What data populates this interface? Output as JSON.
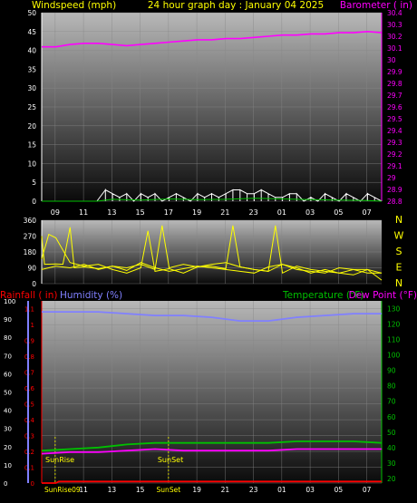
{
  "header": {
    "left_label": "Windspeed (mph)",
    "title": "24 hour graph day : January 04 2025",
    "right_label": "Barometer ( in)"
  },
  "lower_header": {
    "rainfall_label": "Rainfall ( in)",
    "humidity_label": "Humidity (%)",
    "temperature_label": "Temperature (°F)",
    "dewpoint_label": "Dew Point (°F)"
  },
  "colors": {
    "wind": "#ffffff",
    "gust": "#00c000",
    "barometer": "#ff00ff",
    "direction": "#ffff00",
    "rain": "#ff0000",
    "humidity": "#8080ff",
    "temperature": "#00c000",
    "dewpoint": "#ff00ff",
    "title": "#ffff00"
  },
  "chart_data": [
    {
      "type": "line",
      "name": "wind-barometer",
      "x_ticks": [
        "09",
        "11",
        "13",
        "15",
        "17",
        "19",
        "21",
        "23",
        "01",
        "03",
        "05",
        "07"
      ],
      "left_axis": {
        "ticks": [
          0,
          5,
          10,
          15,
          20,
          25,
          30,
          35,
          40,
          45,
          50
        ],
        "ylim": [
          0,
          50
        ]
      },
      "right_axis": {
        "ticks": [
          28.8,
          28.9,
          29,
          29.1,
          29.2,
          29.3,
          29.4,
          29.5,
          29.6,
          29.7,
          29.8,
          29.9,
          30,
          30.1,
          30.2,
          30.3,
          30.4
        ],
        "ylim": [
          28.8,
          30.4
        ]
      },
      "series": [
        {
          "key": "barometer",
          "axis": "right",
          "x": [
            0,
            1,
            2,
            3,
            4,
            5,
            6,
            7,
            8,
            9,
            10,
            11,
            12,
            13,
            14,
            15,
            16,
            17,
            18,
            19,
            20,
            21,
            22,
            23,
            24
          ],
          "values": [
            30.11,
            30.11,
            30.13,
            30.14,
            30.14,
            30.13,
            30.12,
            30.13,
            30.14,
            30.15,
            30.16,
            30.17,
            30.17,
            30.18,
            30.18,
            30.19,
            30.2,
            30.21,
            30.21,
            30.22,
            30.22,
            30.23,
            30.23,
            30.24,
            30.23
          ]
        },
        {
          "key": "wind",
          "axis": "left",
          "x": [
            3.9,
            4.5,
            5,
            5.5,
            6,
            6.5,
            7,
            7.5,
            8,
            8.5,
            9,
            9.5,
            10,
            10.5,
            11,
            11.5,
            12,
            12.5,
            13,
            13.5,
            14,
            14.5,
            15,
            15.5,
            16,
            16.5,
            17,
            17.5,
            18,
            18.5,
            19,
            19.5,
            20,
            20.5,
            21,
            21.5,
            22,
            22.5,
            23,
            23.5,
            24
          ],
          "values": [
            0,
            3,
            2,
            1,
            2,
            0,
            2,
            1,
            2,
            0,
            1,
            2,
            1,
            0,
            2,
            1,
            2,
            1,
            2,
            3,
            3,
            2,
            2,
            3,
            2,
            1,
            1,
            2,
            2,
            0,
            1,
            0,
            2,
            1,
            0,
            2,
            1,
            0,
            2,
            1,
            0
          ]
        },
        {
          "key": "gust",
          "axis": "left",
          "x": [
            0,
            3.9,
            5,
            7,
            9,
            11,
            13,
            15,
            17,
            19,
            21,
            23,
            24
          ],
          "values": [
            0,
            0,
            0.5,
            0.3,
            0.6,
            0.4,
            0.5,
            0.8,
            0.6,
            0.4,
            0.3,
            0.2,
            0
          ]
        }
      ]
    },
    {
      "type": "line",
      "name": "wind-direction",
      "y_ticks": [
        0,
        90,
        180,
        270,
        360
      ],
      "ylim": [
        0,
        360
      ],
      "compass": [
        "N",
        "W",
        "S",
        "E",
        "N"
      ],
      "series": [
        {
          "key": "direction",
          "x": [
            0,
            0.2,
            1,
            1.5,
            2,
            2.3,
            3,
            4,
            5,
            6,
            7,
            8,
            8.5,
            9,
            10,
            11,
            12,
            13,
            13.5,
            14,
            15,
            16,
            16.5,
            17,
            18,
            19,
            20,
            21,
            22,
            23,
            24
          ],
          "values": [
            270,
            110,
            112,
            110,
            320,
            90,
            95,
            85,
            100,
            90,
            110,
            80,
            330,
            90,
            110,
            95,
            100,
            85,
            330,
            95,
            80,
            70,
            330,
            60,
            100,
            80,
            70,
            60,
            80,
            80,
            60
          ]
        },
        {
          "key": "direction",
          "x": [
            0,
            0.5,
            1,
            2,
            3,
            4,
            5,
            6,
            7,
            7.5,
            8,
            9,
            10,
            11,
            12,
            13,
            14,
            15,
            16,
            17,
            18,
            19,
            20,
            21,
            22,
            23,
            24
          ],
          "values": [
            140,
            280,
            260,
            120,
            100,
            110,
            80,
            60,
            90,
            300,
            70,
            85,
            60,
            95,
            110,
            120,
            95,
            80,
            70,
            110,
            90,
            60,
            80,
            60,
            50,
            80,
            20
          ]
        },
        {
          "key": "direction",
          "x": [
            0,
            1,
            2,
            3,
            3.5,
            4,
            5,
            6,
            7,
            8,
            9,
            10,
            11,
            12,
            13,
            14,
            15,
            16,
            17,
            18,
            19,
            20,
            21,
            22,
            23,
            24
          ],
          "values": [
            80,
            100,
            90,
            110,
            95,
            80,
            100,
            75,
            120,
            90,
            70,
            85,
            100,
            90,
            80,
            70,
            60,
            95,
            110,
            80,
            70,
            60,
            90,
            80,
            60,
            60
          ]
        }
      ]
    },
    {
      "type": "line",
      "name": "rain-humidity-temp",
      "rain_axis": {
        "ticks": [
          0,
          0.1,
          0.2,
          0.3,
          0.4,
          0.5,
          0.6,
          0.7,
          0.8,
          0.9,
          1,
          1.1
        ],
        "ylim": [
          0,
          1.15
        ]
      },
      "humidity_axis": {
        "ticks": [
          0,
          10,
          20,
          30,
          40,
          50,
          60,
          70,
          80,
          90,
          100
        ],
        "ylim": [
          0,
          100
        ]
      },
      "temp_axis": {
        "ticks": [
          20,
          30,
          40,
          50,
          60,
          70,
          80,
          90,
          100,
          110,
          120,
          130
        ],
        "ylim": [
          17,
          135
        ]
      },
      "annotations": [
        "SunRise",
        "SunSet"
      ],
      "bottom_labels": [
        "SunRise09",
        "11",
        "13",
        "15",
        "SunSet",
        "19",
        "21",
        "23",
        "01",
        "03",
        "05",
        "07"
      ],
      "series": [
        {
          "key": "humidity",
          "x": [
            0,
            2,
            4,
            6,
            8,
            10,
            12,
            14,
            16,
            18,
            20,
            22,
            24
          ],
          "values": [
            94,
            94,
            94,
            93,
            92,
            92,
            91,
            89,
            89,
            91,
            92,
            93,
            93
          ]
        },
        {
          "key": "temperature",
          "x": [
            0,
            2,
            4,
            6,
            8,
            10,
            12,
            14,
            16,
            18,
            20,
            22,
            24
          ],
          "values": [
            38,
            39,
            40,
            42,
            43,
            43,
            43,
            43,
            43,
            44,
            44,
            44,
            43
          ]
        },
        {
          "key": "dewpoint",
          "x": [
            0,
            2,
            4,
            6,
            8,
            10,
            12,
            14,
            16,
            18,
            20,
            22,
            24
          ],
          "values": [
            36,
            37,
            37,
            38,
            39,
            38,
            38,
            38,
            38,
            39,
            39,
            39,
            39
          ]
        },
        {
          "key": "rain",
          "x": [
            0,
            1,
            1.2,
            24
          ],
          "values": [
            0,
            0,
            0.01,
            0.01
          ]
        }
      ]
    }
  ]
}
